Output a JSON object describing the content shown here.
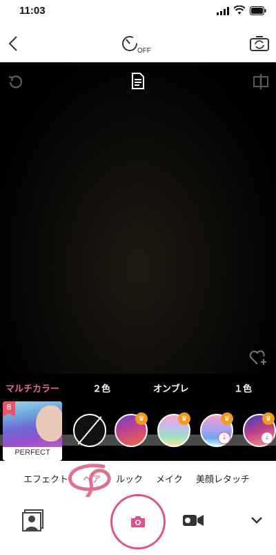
{
  "status_bar": {
    "time": "11:03"
  },
  "header": {
    "timer_state": "OFF"
  },
  "viewer": {},
  "hair_categories": [
    {
      "label": "マルチカラー",
      "active": true
    },
    {
      "label": "２色",
      "active": false
    },
    {
      "label": "オンブレ",
      "active": false
    },
    {
      "label": "１色",
      "active": false
    }
  ],
  "feature_card": {
    "badge_number": "8",
    "label": "PERFECT"
  },
  "mode_tabs": [
    {
      "label": "エフェクト",
      "active": false
    },
    {
      "label": "ヘア",
      "active": true
    },
    {
      "label": "ルック",
      "active": false
    },
    {
      "label": "メイク",
      "active": false
    },
    {
      "label": "美顔レタッチ",
      "active": false
    }
  ],
  "colors": {
    "accent": "#e0508a",
    "category_active": "#e46c93",
    "crown": "#f29b1b"
  }
}
